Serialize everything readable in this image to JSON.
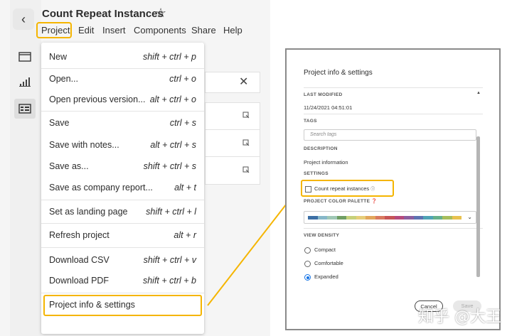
{
  "app": {
    "project_title": "Count Repeat Instances",
    "back_glyph": "‹",
    "star_glyph": "☆"
  },
  "menubar": [
    "Project",
    "Edit",
    "Insert",
    "Components",
    "Share",
    "Help"
  ],
  "project_menu": [
    {
      "label": "New",
      "shortcut": "shift + ctrl + p"
    },
    {
      "label": "Open...",
      "shortcut": "ctrl + o"
    },
    {
      "label": "Open previous version...",
      "shortcut": "alt + ctrl + o"
    },
    {
      "label": "Save",
      "shortcut": "ctrl + s"
    },
    {
      "label": "Save with notes...",
      "shortcut": "alt + ctrl + s"
    },
    {
      "label": "Save as...",
      "shortcut": "shift + ctrl + s"
    },
    {
      "label": "Save as company report...",
      "shortcut": "alt + t"
    },
    {
      "label": "Set as landing page",
      "shortcut": "shift + ctrl + l"
    },
    {
      "label": "Refresh project",
      "shortcut": "alt + r"
    },
    {
      "label": "Download CSV",
      "shortcut": "shift + ctrl + v"
    },
    {
      "label": "Download PDF",
      "shortcut": "shift + ctrl + b"
    },
    {
      "label": "Project info & settings",
      "shortcut": ""
    }
  ],
  "dialog": {
    "title": "Project info & settings",
    "last_modified_label": "LAST MODIFIED",
    "last_modified_value": "11/24/2021 04:51:01",
    "tags_label": "TAGS",
    "tags_placeholder": "Search tags",
    "description_label": "DESCRIPTION",
    "description_value": "Project information",
    "settings_label": "SETTINGS",
    "count_repeat_label": "Count repeat instances",
    "count_repeat_checked": false,
    "palette_label": "PROJECT COLOR PALETTE",
    "palette_colors": [
      "#3d6fa5",
      "#86b7c8",
      "#9fc7b5",
      "#6f9e63",
      "#c6d07a",
      "#e6cd79",
      "#e2a65c",
      "#d9795f",
      "#c65456",
      "#b54a7c",
      "#8b5d9e",
      "#5d72b1",
      "#4fa3b5",
      "#66b08a",
      "#a7bd5b",
      "#e8c14f",
      "#e08b4e",
      "#c9604f",
      "#a8496b",
      "#7d5894",
      "#9c79b8",
      "#8e3f6b"
    ],
    "view_density_label": "VIEW DENSITY",
    "density_options": [
      "Compact",
      "Comfortable",
      "Expanded"
    ],
    "density_selected": "Expanded",
    "cancel_label": "Cancel",
    "save_label": "Save"
  },
  "watermark": "知乎 @大王",
  "colors": {
    "highlight": "#f5b500",
    "accent": "#1473e6"
  }
}
